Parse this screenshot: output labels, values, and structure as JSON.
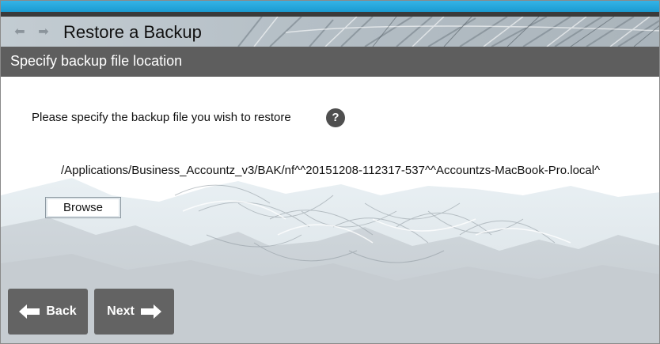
{
  "window": {
    "title": "Restore a Backup"
  },
  "nav": {
    "back_icon": "left-arrow-icon",
    "forward_icon": "right-arrow-icon"
  },
  "section": {
    "header": "Specify backup file location"
  },
  "form": {
    "instruction": "Please specify the backup file you wish to restore",
    "help_symbol": "?",
    "file_path": "/Applications/Business_Accountz_v3/BAK/nf^^20151208-112317-537^^Accountzs-MacBook-Pro.local^",
    "browse_label": "Browse"
  },
  "footer": {
    "back_label": "Back",
    "next_label": "Next"
  },
  "colors": {
    "accent_blue": "#1a9bd2",
    "header_gray": "#5e5e5e",
    "button_gray": "#636363"
  }
}
